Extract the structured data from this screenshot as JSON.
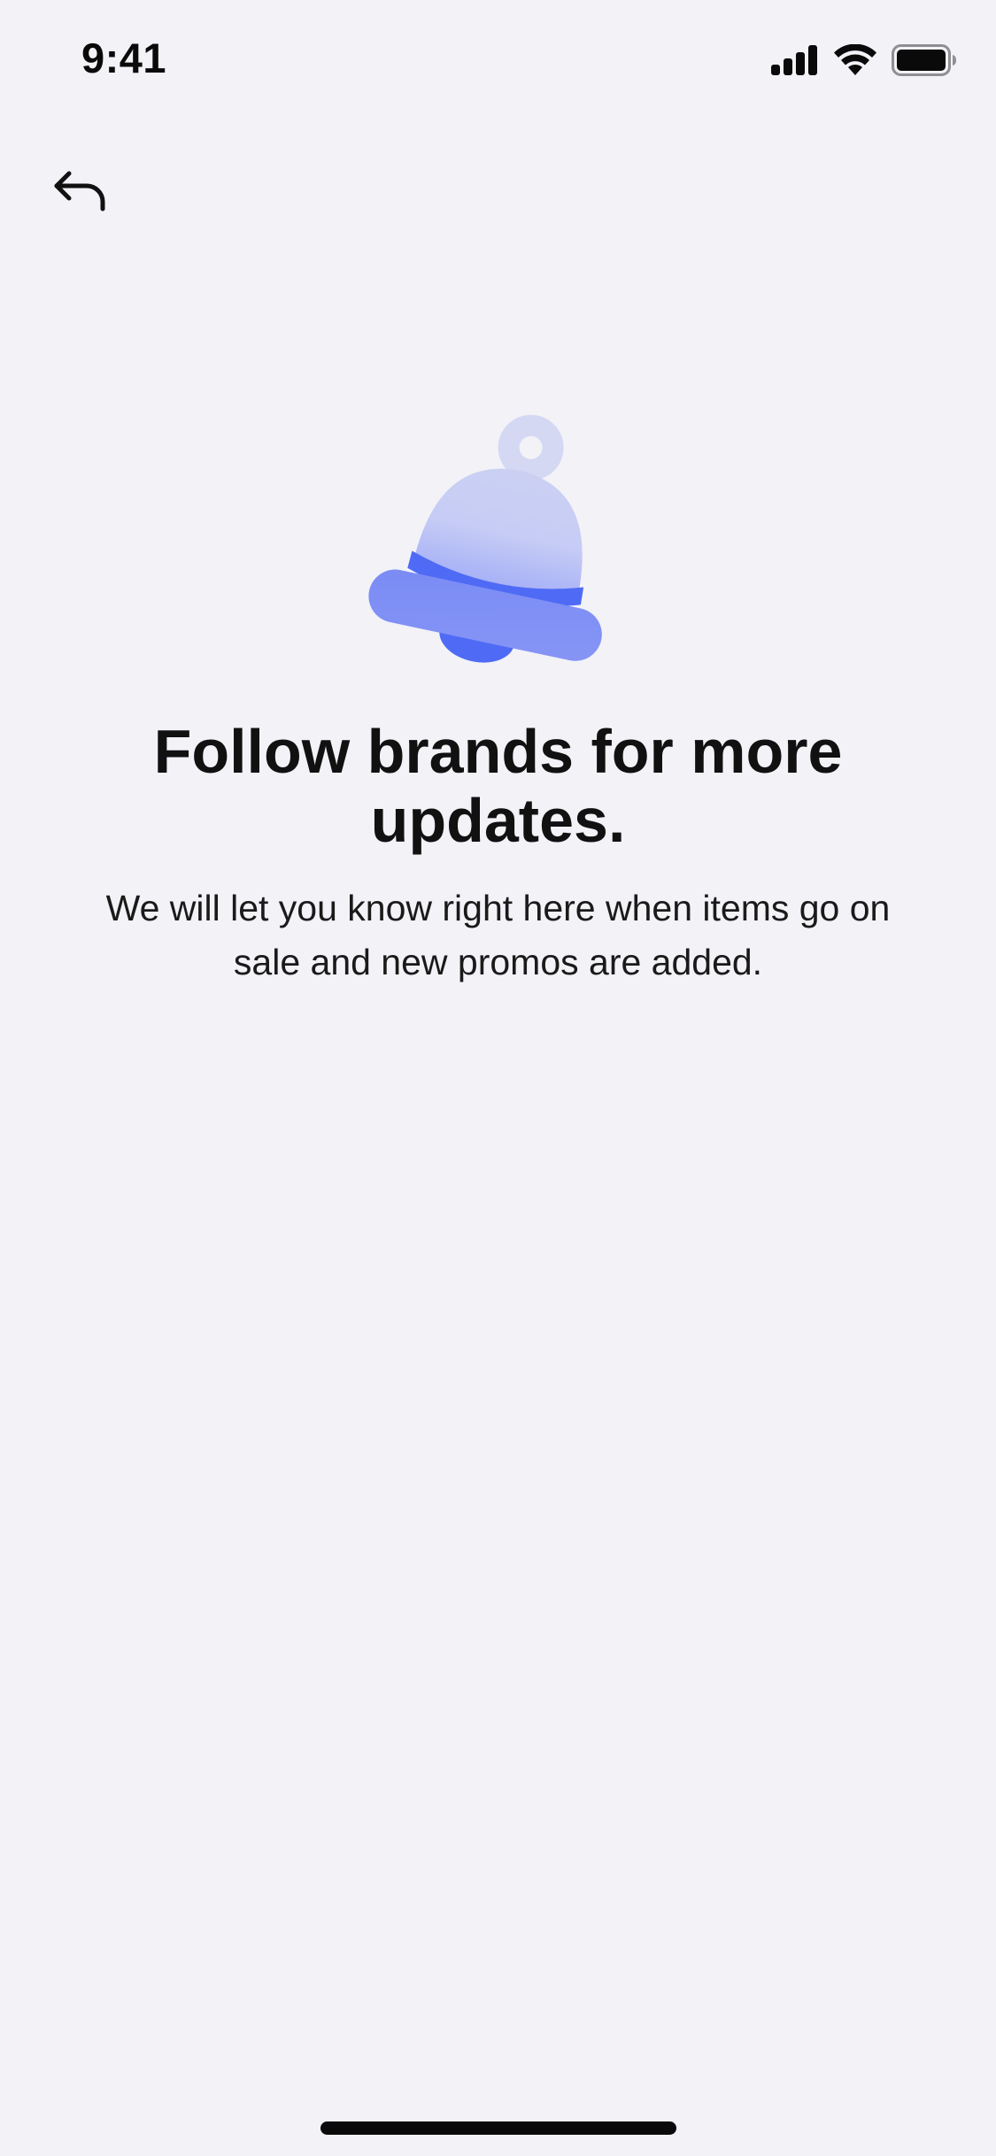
{
  "status_bar": {
    "time": "9:41",
    "icons": [
      "cellular-signal-icon",
      "wifi-icon",
      "battery-icon"
    ]
  },
  "navigation": {
    "back_icon": "back-arrow-icon"
  },
  "empty_state": {
    "illustration": "bell-icon",
    "title": "Follow brands for more updates.",
    "subtitle": "We will let you know right here when items go on sale and new promos are added."
  },
  "colors": {
    "background": "#F2F2F7",
    "text": "#111111",
    "accent": "#4F6BF5",
    "bell_light": "#C9CEF4",
    "bell_mid": "#7C8DF4"
  }
}
